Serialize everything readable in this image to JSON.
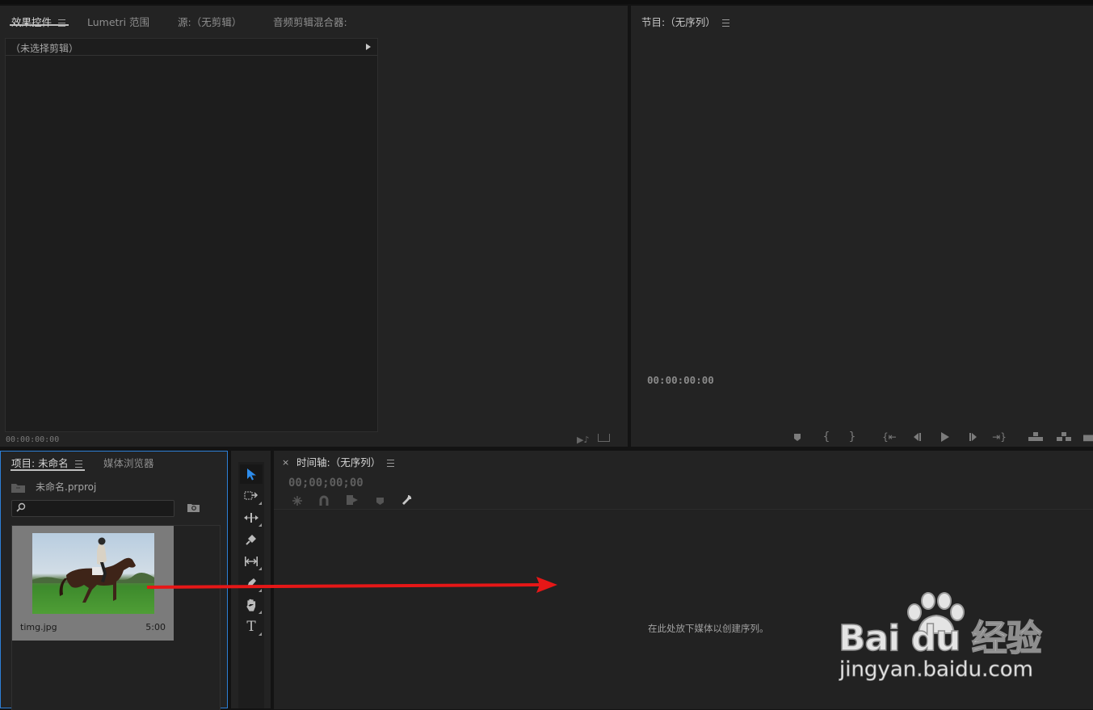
{
  "effects_panel": {
    "tabs": [
      {
        "label": "效果控件",
        "active": true
      },
      {
        "label": "Lumetri 范围"
      },
      {
        "label": "源:（无剪辑）"
      },
      {
        "label": "音频剪辑混合器:"
      }
    ],
    "clip_header": "（未选择剪辑）",
    "timecode": "00:00:00:00"
  },
  "program_panel": {
    "title": "节目:（无序列）",
    "timecode": "00:00:00:00"
  },
  "project_panel": {
    "tabs": [
      {
        "label": "项目: 未命名",
        "active": true
      },
      {
        "label": "媒体浏览器"
      }
    ],
    "project_file": "未命名.prproj",
    "search_placeholder": "",
    "item": {
      "name": "timg.jpg",
      "duration": "5:00"
    }
  },
  "timeline_panel": {
    "close_glyph": "×",
    "title": "时间轴:（无序列）",
    "timecode": "00;00;00;00",
    "drop_hint": "在此处放下媒体以创建序列。"
  },
  "watermark": {
    "brand": "Bai du 经验",
    "url": "jingyan.baidu.com"
  },
  "colors": {
    "accent_blue": "#2d8ceb",
    "arrow_red": "#e61717",
    "panel_bg": "#232323"
  }
}
